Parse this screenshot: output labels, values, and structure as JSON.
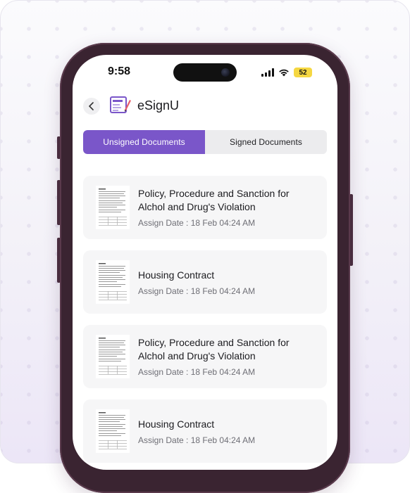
{
  "status_bar": {
    "time": "9:58",
    "battery": "52"
  },
  "header": {
    "title": "eSignU"
  },
  "tabs": [
    {
      "label": "Unsigned Documents",
      "active": true
    },
    {
      "label": "Signed Documents",
      "active": false
    }
  ],
  "documents": [
    {
      "title": "Policy, Procedure and Sanction for Alchol and Drug's Violation",
      "date": "Assign Date : 18 Feb 04:24 AM"
    },
    {
      "title": "Housing Contract",
      "date": "Assign Date : 18 Feb 04:24 AM"
    },
    {
      "title": "Policy, Procedure and Sanction for Alchol and Drug's Violation",
      "date": "Assign Date : 18 Feb 04:24 AM"
    },
    {
      "title": "Housing Contract",
      "date": "Assign Date : 18 Feb 04:24 AM"
    }
  ],
  "colors": {
    "accent": "#7a56c9",
    "phone_frame": "#3a2431",
    "battery": "#f5d742"
  }
}
